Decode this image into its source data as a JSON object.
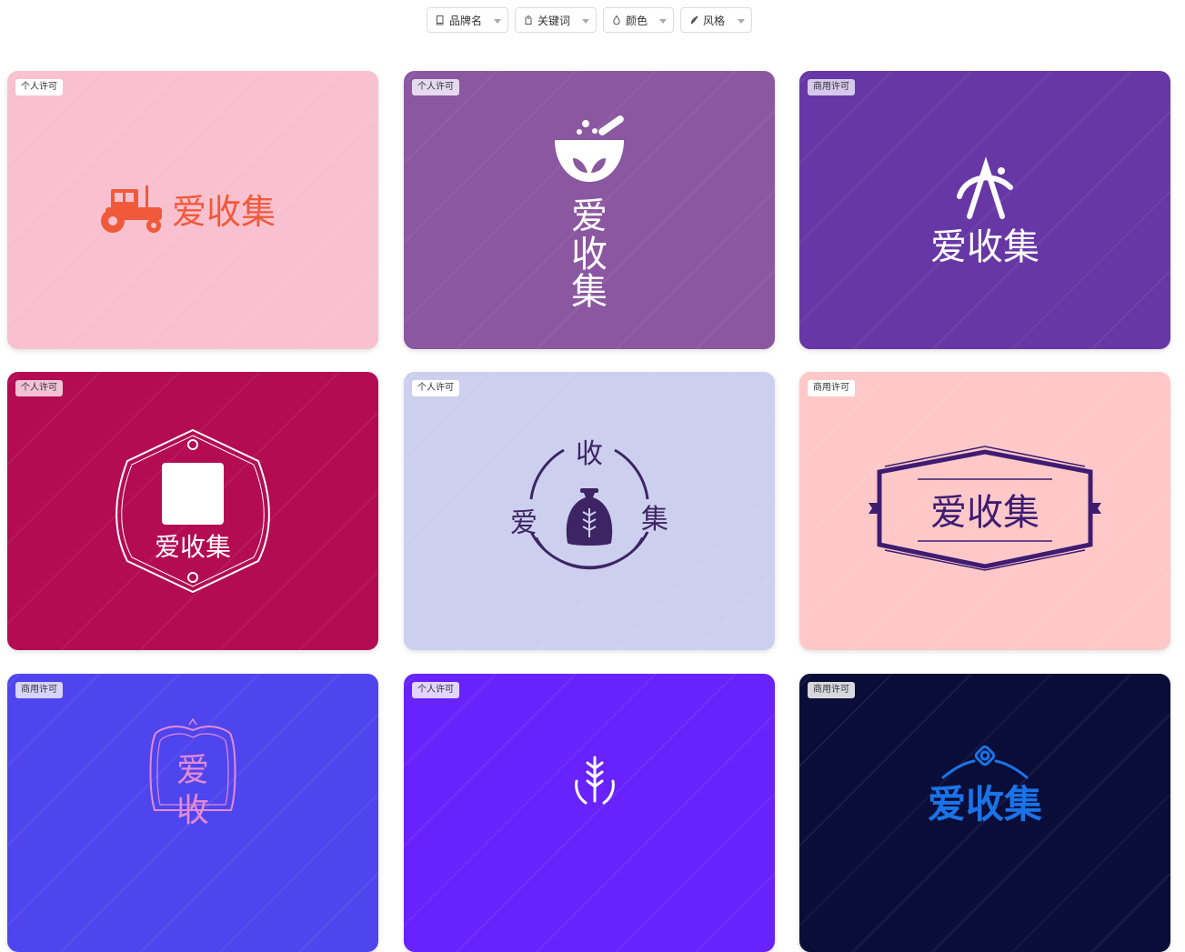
{
  "filters": [
    {
      "label": "品牌名",
      "icon": "book-icon"
    },
    {
      "label": "关键词",
      "icon": "tag-icon"
    },
    {
      "label": "颜色",
      "icon": "droplet-icon"
    },
    {
      "label": "风格",
      "icon": "brush-icon"
    }
  ],
  "logo_text": "爱收集",
  "logo_chars": [
    "爱",
    "收",
    "集"
  ],
  "cards": [
    {
      "license": "个人许可",
      "bg": "#f9c1d0",
      "icon": "tractor-icon"
    },
    {
      "license": "个人许可",
      "bg": "#8a57a0",
      "icon": "mortar-pestle-icon"
    },
    {
      "license": "商用许可",
      "bg": "#6737a5",
      "icon": "letter-a-icon"
    },
    {
      "license": "个人许可",
      "bg": "#b30c53",
      "icon": "hexagon-frame-icon"
    },
    {
      "license": "个人许可",
      "bg": "#cdcfee",
      "icon": "grain-sack-icon"
    },
    {
      "license": "商用许可",
      "bg": "#ffc8c8",
      "icon": "hexagon-banner-icon"
    },
    {
      "license": "商用许可",
      "bg": "#4f45ee",
      "icon": "ornate-frame-icon"
    },
    {
      "license": "个人许可",
      "bg": "#6822fb",
      "icon": "wheat-icon"
    },
    {
      "license": "商用许可",
      "bg": "#0a0d37",
      "icon": "flower-arc-icon"
    }
  ],
  "colors": {
    "tractor": "#f05a3a",
    "dark_purple": "#3d2464",
    "deep_purple": "#3d1c72",
    "blue_text": "#1a73e8",
    "pink_outline": "#e48ad6"
  }
}
